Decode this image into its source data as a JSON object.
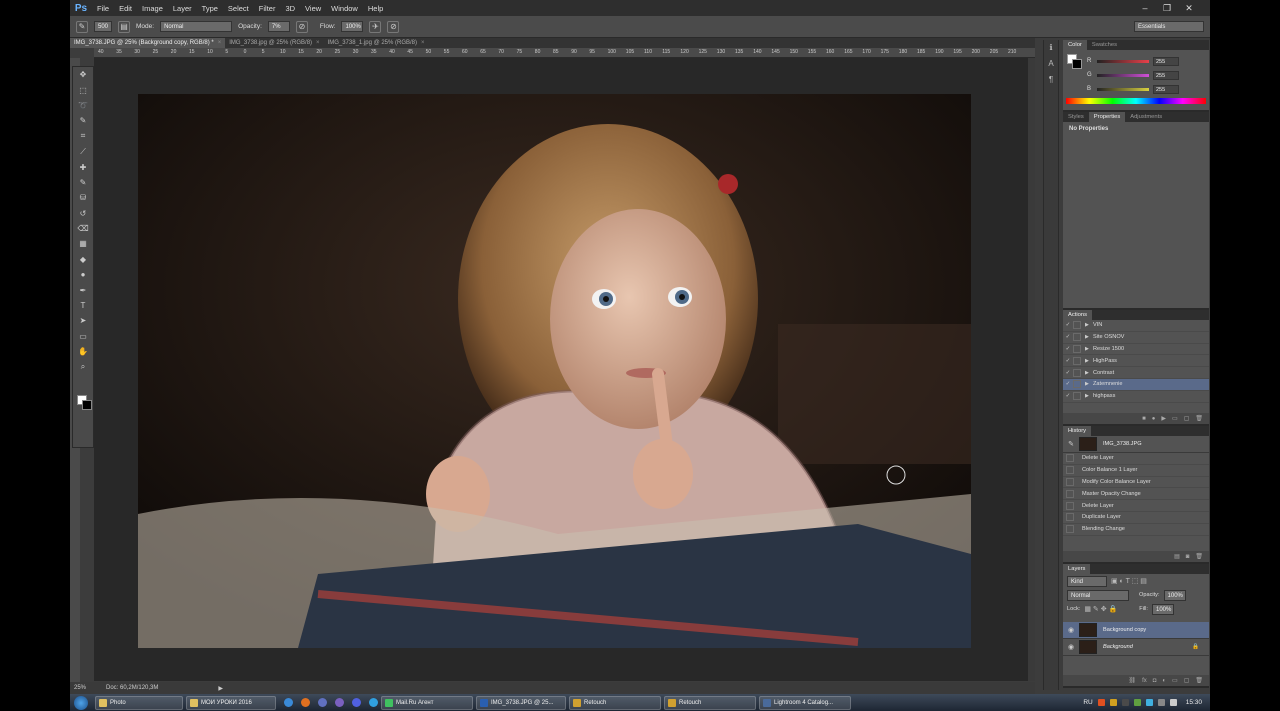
{
  "menubar": {
    "logo": "Ps",
    "items": [
      "File",
      "Edit",
      "Image",
      "Layer",
      "Type",
      "Select",
      "Filter",
      "3D",
      "View",
      "Window",
      "Help"
    ]
  },
  "options": {
    "brush_size": "500",
    "mode_label": "Mode:",
    "mode_value": "Normal",
    "opacity_label": "Opacity:",
    "opacity_value": "7%",
    "flow_label": "Flow:",
    "flow_value": "100%",
    "workspace": "Essentials"
  },
  "doc_tabs": [
    {
      "label": "IMG_3738.JPG @ 25% (Background copy, RGB/8) *",
      "close": "×"
    },
    {
      "label": "IMG_3738.jpg @ 25% (RGB/8)",
      "close": "×"
    },
    {
      "label": "IMG_3738_1.jpg @ 25% (RGB/8)",
      "close": "×"
    }
  ],
  "ruler_ticks": [
    "40",
    "35",
    "30",
    "25",
    "20",
    "15",
    "10",
    "5",
    "0",
    "5",
    "10",
    "15",
    "20",
    "25",
    "30",
    "35",
    "40",
    "45",
    "50",
    "55",
    "60",
    "65",
    "70",
    "75",
    "80",
    "85",
    "90",
    "95",
    "100",
    "105",
    "110",
    "115",
    "120",
    "125",
    "130",
    "135",
    "140",
    "145",
    "150",
    "155",
    "160",
    "165",
    "170",
    "175",
    "180",
    "185",
    "190",
    "195",
    "200",
    "205",
    "210"
  ],
  "tool_icons": [
    "move",
    "marquee",
    "lasso",
    "quick-select",
    "crop",
    "eyedropper",
    "healing",
    "brush",
    "stamp",
    "history-brush",
    "eraser",
    "gradient",
    "blur",
    "dodge",
    "pen",
    "type",
    "path-select",
    "shape",
    "hand",
    "zoom"
  ],
  "status": {
    "zoom": "25%",
    "doc": "Doc: 60,2M/120,3M",
    "arrow": "▶"
  },
  "color_panel": {
    "tabs": [
      "Color",
      "Swatches"
    ],
    "channels": [
      {
        "ch": "R",
        "value": "255",
        "color": "#e8404a"
      },
      {
        "ch": "G",
        "value": "255",
        "color": "#d050d8"
      },
      {
        "ch": "B",
        "value": "255",
        "color": "#d8d040"
      }
    ]
  },
  "properties_panel": {
    "tabs": [
      "Styles",
      "Properties",
      "Adjustments"
    ],
    "body": "No Properties"
  },
  "actions_panel": {
    "title": "Actions",
    "items": [
      "VIN",
      "Site OSNOV",
      "Resize 1500",
      "HighPass",
      "Contrast",
      "Zatemnenie",
      "highpass"
    ],
    "selected": "Zatemnenie"
  },
  "history_panel": {
    "title": "History",
    "snapshot": "IMG_3738.JPG",
    "items": [
      "Delete Layer",
      "Color Balance 1 Layer",
      "Modify Color Balance Layer",
      "Master Opacity Change",
      "Delete Layer",
      "Duplicate Layer",
      "Blending Change"
    ]
  },
  "layers_panel": {
    "title": "Layers",
    "kind": "Kind",
    "blend": "Normal",
    "opacity_label": "Opacity:",
    "opacity": "100%",
    "lock_label": "Lock:",
    "fill_label": "Fill:",
    "fill": "100%",
    "layers": [
      {
        "name": "Background copy",
        "selected": true
      },
      {
        "name": "Background",
        "selected": false
      }
    ]
  },
  "taskbar": {
    "buttons": [
      {
        "label": "Photo",
        "icon_color": "#e0c060"
      },
      {
        "label": "МОИ УРОКИ 2016",
        "icon_color": "#e0c060"
      },
      {
        "label": "Mail.Ru Агент",
        "icon_color": "#40c060"
      },
      {
        "label": "IMG_3738.JPG @ 25...",
        "icon_color": "#2a5fb0"
      },
      {
        "label": "Retouch",
        "icon_color": "#d0a030"
      },
      {
        "label": "Retouch",
        "icon_color": "#d0a030"
      },
      {
        "label": "Lightroom 4 Catalog...",
        "icon_color": "#4a6a9a"
      }
    ],
    "lang": "RU",
    "time": "15:30"
  }
}
